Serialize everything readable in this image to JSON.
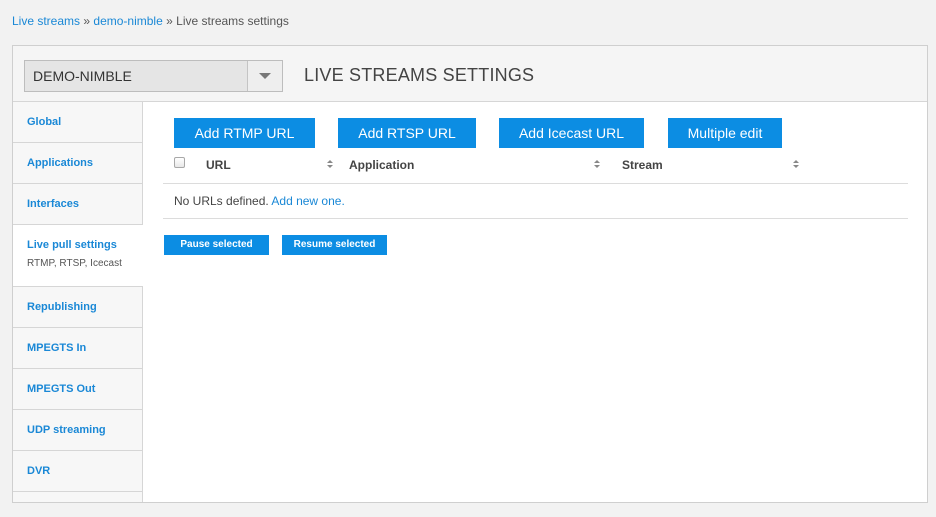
{
  "breadcrumb": {
    "items": [
      "Live streams",
      "demo-nimble",
      "Live streams settings"
    ],
    "separator": "»"
  },
  "header": {
    "server_select": "DEMO-NIMBLE",
    "title": "LIVE STREAMS SETTINGS"
  },
  "sidebar": {
    "items": [
      {
        "label": "Global"
      },
      {
        "label": "Applications"
      },
      {
        "label": "Interfaces"
      },
      {
        "label": "Live pull settings",
        "sub": "RTMP, RTSP, Icecast"
      },
      {
        "label": "Republishing"
      },
      {
        "label": "MPEGTS In"
      },
      {
        "label": "MPEGTS Out"
      },
      {
        "label": "UDP streaming"
      },
      {
        "label": "DVR"
      }
    ]
  },
  "toolbar": {
    "add_rtmp": "Add RTMP URL",
    "add_rtsp": "Add RTSP URL",
    "add_icecast": "Add Icecast URL",
    "multiple_edit": "Multiple edit"
  },
  "table": {
    "columns": [
      "URL",
      "Application",
      "Stream"
    ],
    "empty_text": "No URLs defined.",
    "empty_link": "Add new one."
  },
  "actions": {
    "pause": "Pause selected",
    "resume": "Resume selected"
  },
  "colors": {
    "accent": "#0c8de3",
    "link": "#1a88d6"
  }
}
